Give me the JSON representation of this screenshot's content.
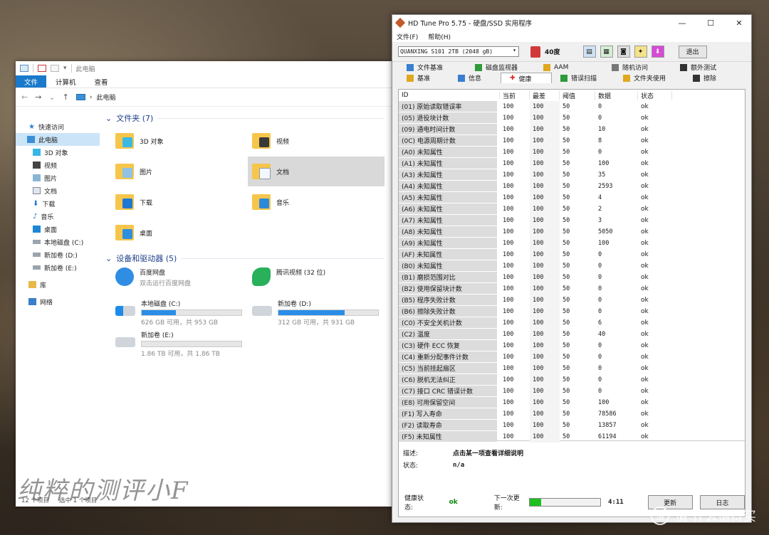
{
  "explorer": {
    "title": "此电脑",
    "ribbon_tabs": [
      "文件",
      "计算机",
      "查看"
    ],
    "address": "此电脑",
    "nav_items": [
      {
        "label": "快速访问",
        "icon": "star-icon"
      },
      {
        "label": "此电脑",
        "icon": "pc-icon"
      },
      {
        "label": "3D 对象",
        "icon": "cube-icon"
      },
      {
        "label": "视频",
        "icon": "video-icon"
      },
      {
        "label": "图片",
        "icon": "picture-icon"
      },
      {
        "label": "文档",
        "icon": "document-icon"
      },
      {
        "label": "下载",
        "icon": "download-icon"
      },
      {
        "label": "音乐",
        "icon": "music-icon"
      },
      {
        "label": "桌面",
        "icon": "desktop-icon"
      },
      {
        "label": "本地磁盘 (C:)",
        "icon": "drive-icon"
      },
      {
        "label": "新加卷 (D:)",
        "icon": "drive-icon"
      },
      {
        "label": "新加卷 (E:)",
        "icon": "drive-icon"
      },
      {
        "label": "库",
        "icon": "library-icon"
      },
      {
        "label": "网络",
        "icon": "network-icon"
      }
    ],
    "folders_header": "文件夹 (7)",
    "folders": [
      {
        "label": "3D 对象",
        "icon": "3d-objects-folder-icon"
      },
      {
        "label": "视频",
        "icon": "videos-folder-icon"
      },
      {
        "label": "图片",
        "icon": "pictures-folder-icon"
      },
      {
        "label": "文档",
        "icon": "documents-folder-icon"
      },
      {
        "label": "下载",
        "icon": "downloads-folder-icon"
      },
      {
        "label": "音乐",
        "icon": "music-folder-icon"
      },
      {
        "label": "桌面",
        "icon": "desktop-folder-icon"
      }
    ],
    "devices_header": "设备和驱动器 (5)",
    "devices": [
      {
        "name": "百度网盘",
        "sub": "双击运行百度网盘",
        "icon": "baidu-netdisk-icon"
      },
      {
        "name": "腾讯视频 (32 位)",
        "sub": "",
        "icon": "tencent-video-icon"
      },
      {
        "name": "本地磁盘 (C:)",
        "sub": "626 GB 可用，共 953 GB",
        "used_fraction": 0.343,
        "icon": "windows-drive-icon"
      },
      {
        "name": "新加卷 (D:)",
        "sub": "312 GB 可用，共 931 GB",
        "used_fraction": 0.665,
        "icon": "drive-icon"
      },
      {
        "name": "新加卷 (E:)",
        "sub": "1.86 TB 可用，共 1.86 TB",
        "used_fraction": 0.0,
        "icon": "drive-icon"
      }
    ],
    "status_items": "12 个项目",
    "status_selected": "选中 1 个项目",
    "watermark": "纯粹的测评小F"
  },
  "hdtune": {
    "title": "HD Tune Pro 5.75 - 硬盘/SSD 实用程序",
    "menu": [
      "文件(F)",
      "帮助(H)"
    ],
    "drive": "QUANXING S101 2TB (2048 gB)",
    "temperature": "40度",
    "exit_label": "退出",
    "tabs_row1": [
      {
        "label": "文件基准",
        "icon": "file-benchmark-icon"
      },
      {
        "label": "磁盘监视器",
        "icon": "disk-monitor-icon"
      },
      {
        "label": "AAM",
        "icon": "speaker-icon"
      },
      {
        "label": "随机访问",
        "icon": "random-access-icon"
      },
      {
        "label": "额外测试",
        "icon": "extra-tests-icon"
      }
    ],
    "tabs_row2": [
      {
        "label": "基准",
        "icon": "benchmark-icon"
      },
      {
        "label": "信息",
        "icon": "info-icon"
      },
      {
        "label": "健康",
        "icon": "health-cross-icon",
        "active": true
      },
      {
        "label": "错误扫描",
        "icon": "error-scan-icon"
      },
      {
        "label": "文件夹使用",
        "icon": "folder-usage-icon"
      },
      {
        "label": "擦除",
        "icon": "erase-icon"
      }
    ],
    "columns": [
      "ID",
      "当前",
      "最差",
      "阈值",
      "数据",
      "状态"
    ],
    "rows": [
      [
        "(01) 原始读取错误率",
        "100",
        "100",
        "50",
        "0",
        "ok"
      ],
      [
        "(05) 退役块计数",
        "100",
        "100",
        "50",
        "0",
        "ok"
      ],
      [
        "(09) 通电时间计数",
        "100",
        "100",
        "50",
        "10",
        "ok"
      ],
      [
        "(0C) 电源周期计数",
        "100",
        "100",
        "50",
        "8",
        "ok"
      ],
      [
        "(A0) 未知属性",
        "100",
        "100",
        "50",
        "0",
        "ok"
      ],
      [
        "(A1) 未知属性",
        "100",
        "100",
        "50",
        "100",
        "ok"
      ],
      [
        "(A3) 未知属性",
        "100",
        "100",
        "50",
        "35",
        "ok"
      ],
      [
        "(A4) 未知属性",
        "100",
        "100",
        "50",
        "2593",
        "ok"
      ],
      [
        "(A5) 未知属性",
        "100",
        "100",
        "50",
        "4",
        "ok"
      ],
      [
        "(A6) 未知属性",
        "100",
        "100",
        "50",
        "2",
        "ok"
      ],
      [
        "(A7) 未知属性",
        "100",
        "100",
        "50",
        "3",
        "ok"
      ],
      [
        "(A8) 未知属性",
        "100",
        "100",
        "50",
        "5050",
        "ok"
      ],
      [
        "(A9) 未知属性",
        "100",
        "100",
        "50",
        "100",
        "ok"
      ],
      [
        "(AF) 未知属性",
        "100",
        "100",
        "50",
        "0",
        "ok"
      ],
      [
        "(B0) 未知属性",
        "100",
        "100",
        "50",
        "0",
        "ok"
      ],
      [
        "(B1) 磨损范围对比",
        "100",
        "100",
        "50",
        "0",
        "ok"
      ],
      [
        "(B2) 使用保留块计数",
        "100",
        "100",
        "50",
        "0",
        "ok"
      ],
      [
        "(B5) 程序失败计数",
        "100",
        "100",
        "50",
        "0",
        "ok"
      ],
      [
        "(B6) 擦除失败计数",
        "100",
        "100",
        "50",
        "0",
        "ok"
      ],
      [
        "(C0) 不安全关机计数",
        "100",
        "100",
        "50",
        "6",
        "ok"
      ],
      [
        "(C2) 温度",
        "100",
        "100",
        "50",
        "40",
        "ok"
      ],
      [
        "(C3) 硬件 ECC 恢复",
        "100",
        "100",
        "50",
        "0",
        "ok"
      ],
      [
        "(C4) 重新分配事件计数",
        "100",
        "100",
        "50",
        "0",
        "ok"
      ],
      [
        "(C5) 当前挂起扇区",
        "100",
        "100",
        "50",
        "0",
        "ok"
      ],
      [
        "(C6) 脱机无法纠正",
        "100",
        "100",
        "50",
        "0",
        "ok"
      ],
      [
        "(C7) 接口 CRC 错误计数",
        "100",
        "100",
        "50",
        "0",
        "ok"
      ],
      [
        "(E8) 可用保留空间",
        "100",
        "100",
        "50",
        "100",
        "ok"
      ],
      [
        "(F1) 写入寿命",
        "100",
        "100",
        "50",
        "78586",
        "ok"
      ],
      [
        "(F2) 读取寿命",
        "100",
        "100",
        "50",
        "13857",
        "ok"
      ],
      [
        "(F5) 未知属性",
        "100",
        "100",
        "50",
        "61194",
        "ok"
      ]
    ],
    "desc_label": "描述:",
    "desc_value": "点击某一项查看详细说明",
    "status_label": "状态:",
    "status_value": "n/a",
    "health_label": "健康状态:",
    "health_value": "ok",
    "next_update_label": "下一次更新:",
    "next_update_progress": 0.16,
    "next_update_time": "4:11",
    "refresh_label": "更新",
    "log_label": "日志",
    "colors": {
      "health_ok": "#0a8a0a",
      "progress": "#1fbf1f"
    }
  },
  "site_watermark": "值 什么值得买"
}
